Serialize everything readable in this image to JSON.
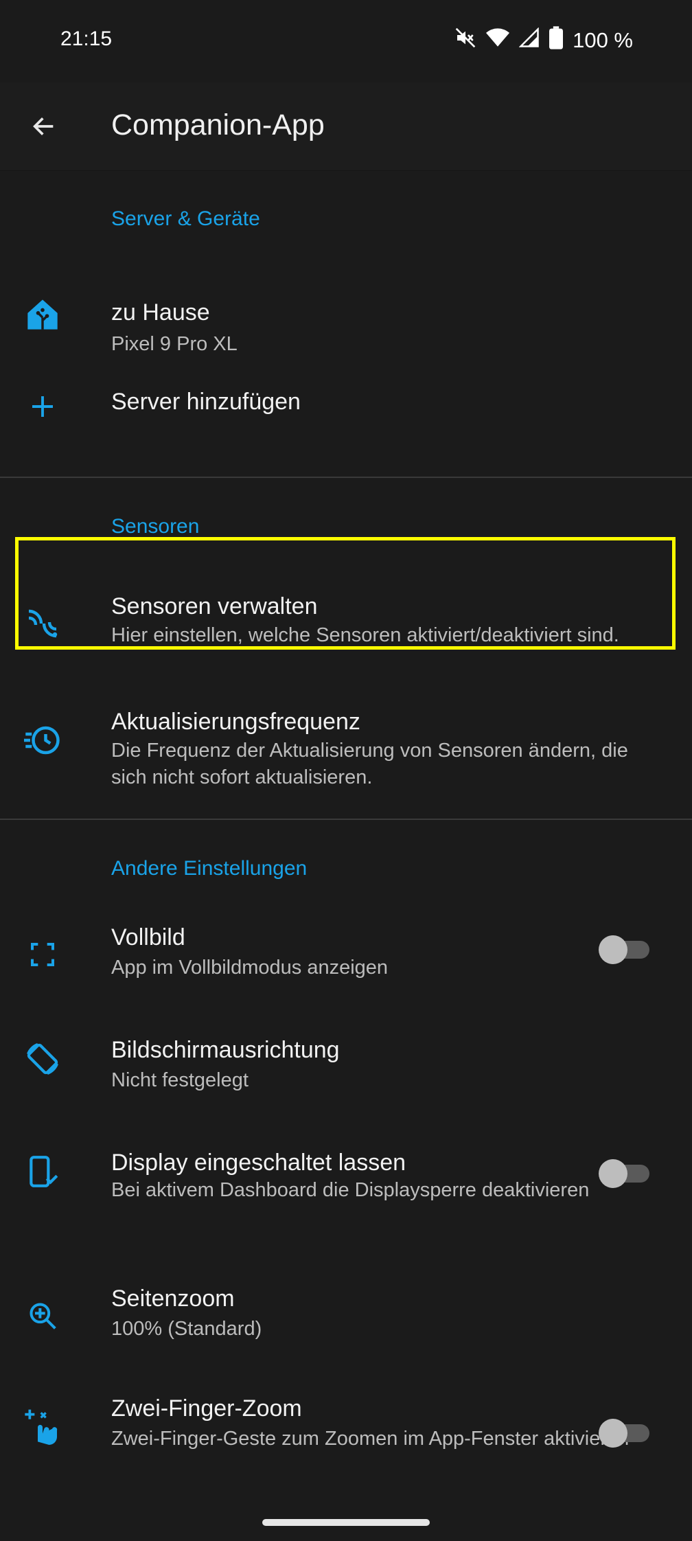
{
  "status": {
    "time": "21:15",
    "battery": "100 %",
    "icons": [
      "mute-icon",
      "wifi-icon",
      "signal-icon",
      "battery-icon"
    ]
  },
  "appbar": {
    "title": "Companion-App",
    "back_icon": "arrow-left-icon"
  },
  "sections": {
    "server": {
      "header": "Server & Geräte",
      "home": {
        "title": "zu Hause",
        "subtitle": "Pixel 9 Pro XL",
        "icon": "home-assistant-icon"
      },
      "add": {
        "title": "Server hinzufügen",
        "icon": "plus-icon"
      }
    },
    "sensors": {
      "header": "Sensoren",
      "manage": {
        "title": "Sensoren verwalten",
        "subtitle": "Hier einstellen, welche Sensoren aktiviert/deaktiviert sind.",
        "icon": "sensor-waves-icon"
      },
      "frequency": {
        "title": "Aktualisierungsfrequenz",
        "subtitle": "Die Frequenz der Aktualisierung von Sensoren ändern, die sich nicht sofort aktualisieren.",
        "icon": "update-clock-icon"
      }
    },
    "other": {
      "header": "Andere Einstellungen",
      "fullscreen": {
        "title": "Vollbild",
        "subtitle": "App im Vollbildmodus anzeigen",
        "icon": "fullscreen-icon",
        "enabled": false
      },
      "orientation": {
        "title": "Bildschirmausrichtung",
        "subtitle": "Nicht festgelegt",
        "icon": "screen-rotation-icon"
      },
      "keep_screen_on": {
        "title": "Display eingeschaltet lassen",
        "subtitle": "Bei aktivem Dashboard die Displaysperre deaktivieren",
        "icon": "phone-check-icon",
        "enabled": false
      },
      "page_zoom": {
        "title": "Seitenzoom",
        "subtitle": "100% (Standard)",
        "icon": "zoom-in-icon"
      },
      "pinch_zoom": {
        "title": "Zwei-Finger-Zoom",
        "subtitle": "Zwei-Finger-Geste zum Zoomen im App-Fenster aktivieren",
        "icon": "gesture-pinch-icon",
        "enabled": false
      }
    }
  },
  "colors": {
    "accent": "#1aa3e8",
    "highlight": "#ffff00",
    "background": "#1b1b1b"
  }
}
